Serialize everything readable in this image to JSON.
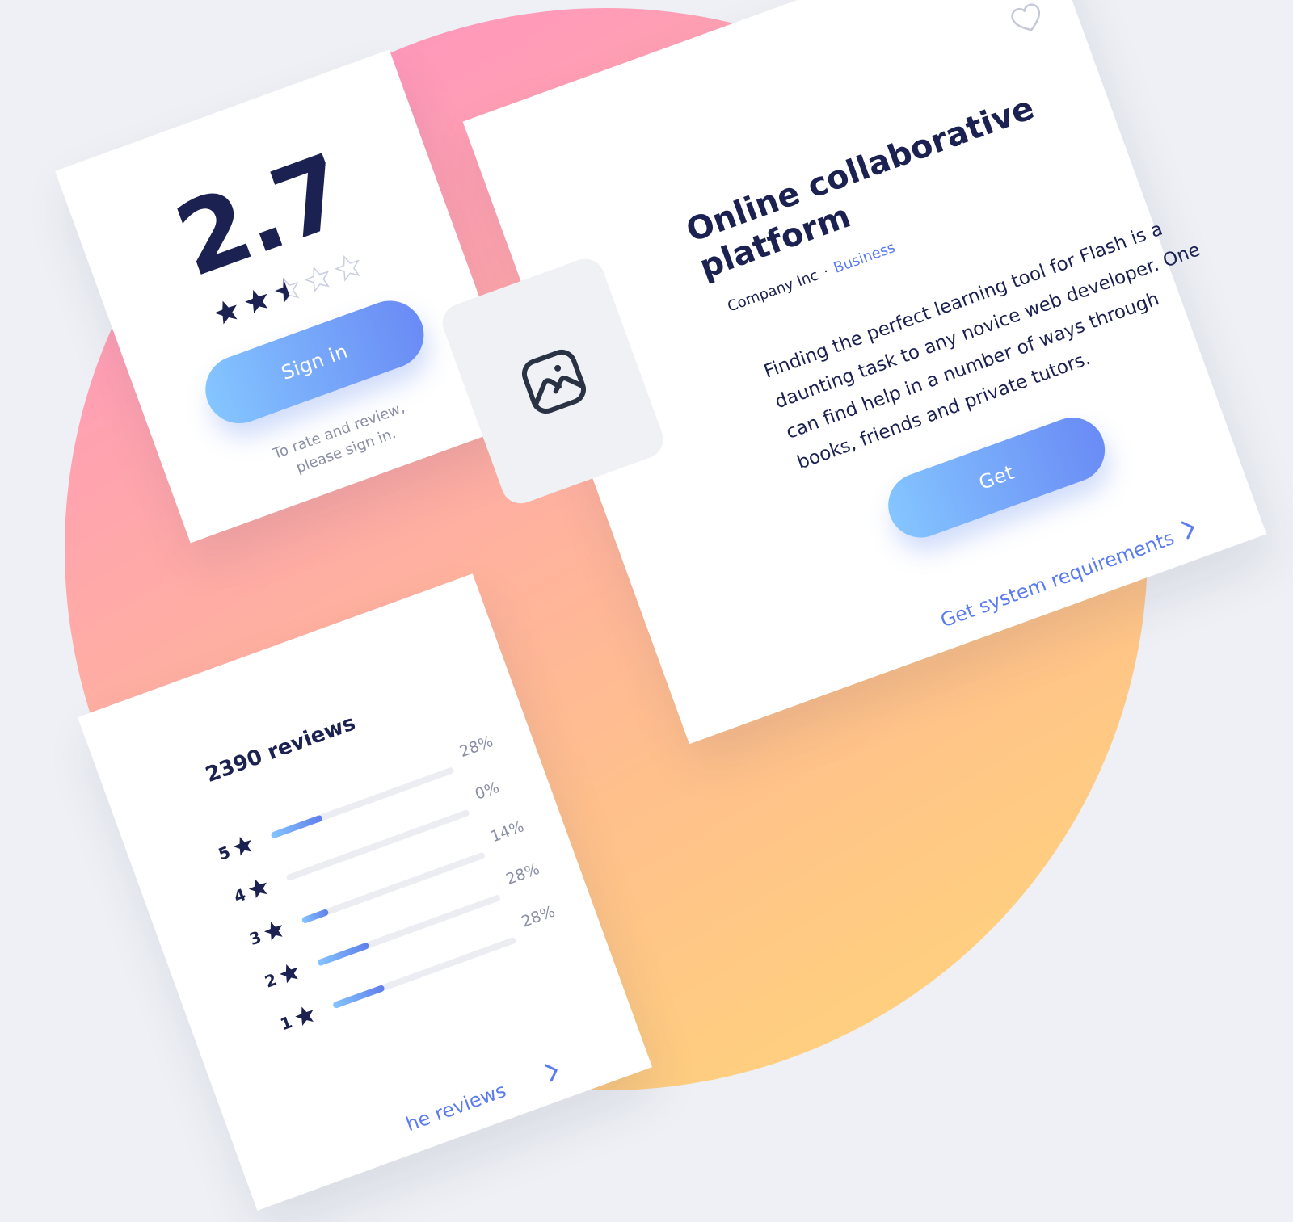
{
  "rating_card": {
    "score": "2.7",
    "stars": [
      1,
      1,
      0.5,
      0,
      0
    ],
    "sign_in_label": "Sign in",
    "hint_line1": "To rate and review,",
    "hint_line2": "please sign in."
  },
  "reviews_card": {
    "title": "2390 reviews",
    "rows": [
      {
        "stars": "5",
        "percent": "28%",
        "fill": 0.28
      },
      {
        "stars": "4",
        "percent": "0%",
        "fill": 0
      },
      {
        "stars": "3",
        "percent": "14%",
        "fill": 0.14
      },
      {
        "stars": "2",
        "percent": "28%",
        "fill": 0.28
      },
      {
        "stars": "1",
        "percent": "28%",
        "fill": 0.28
      }
    ],
    "see_link": "he reviews"
  },
  "product_card": {
    "title": "Online collaborative platform",
    "company": "Company Inc",
    "category": "Business",
    "description": "Finding the perfect learning tool for Flash is a daunting task to any novice web developer. One can find help in a number of ways through books, friends and private tutors.",
    "get_label": "Get",
    "requirements_link": "Get system requirements"
  },
  "colors": {
    "accent": "#5B7CF0",
    "navy": "#1B2150",
    "muted": "#8A8FA3"
  },
  "icons": [
    "star-icon",
    "half-star-icon",
    "heart-icon",
    "image-icon",
    "chevron-right-icon"
  ]
}
